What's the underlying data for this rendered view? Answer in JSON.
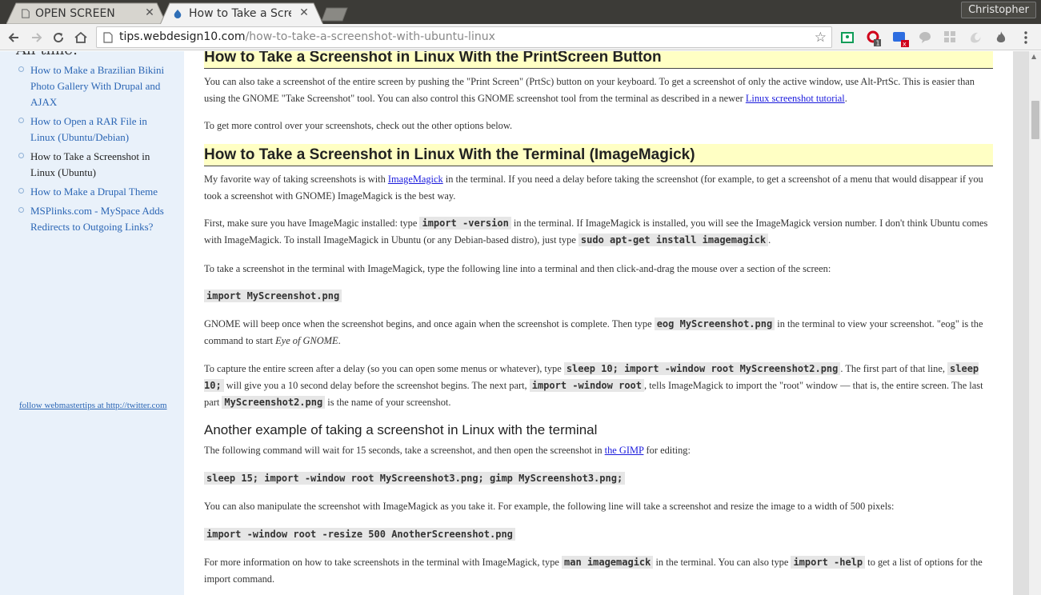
{
  "tabs": [
    {
      "title": "OPEN SCREEN",
      "active": false
    },
    {
      "title": "How to Take a Scre",
      "active": true
    }
  ],
  "profile": {
    "name": "Christopher"
  },
  "omnibox": {
    "host": "tips.webdesign10.com",
    "path": "/how-to-take-a-screenshot-with-ubuntu-linux"
  },
  "extensions": [
    {
      "icon": "google-classroom-icon",
      "badge": ""
    },
    {
      "icon": "opera-icon",
      "badge": "1"
    },
    {
      "icon": "screen-capture-icon",
      "badge": "x"
    },
    {
      "icon": "speech-bubble-icon",
      "badge": ""
    },
    {
      "icon": "grid-icon",
      "badge": ""
    },
    {
      "icon": "swirl-icon",
      "badge": ""
    },
    {
      "icon": "flame-icon",
      "badge": ""
    }
  ],
  "sidebar": {
    "heading": "All time:",
    "items": [
      {
        "label": "How to Make a Brazilian Bikini Photo Gallery With Drupal and AJAX",
        "current": false
      },
      {
        "label": "How to Open a RAR File in Linux (Ubuntu/Debian)",
        "current": false
      },
      {
        "label": "How to Take a Screenshot in Linux (Ubuntu)",
        "current": true
      },
      {
        "label": "How to Make a Drupal Theme",
        "current": false
      },
      {
        "label": "MSPlinks.com - MySpace Adds Redirects to Outgoing Links?",
        "current": false
      }
    ],
    "follow": "follow webmastertips at http://twitter.com"
  },
  "article": {
    "h_printscreen": "How to Take a Screenshot in Linux With the PrintScreen Button",
    "p1_a": "You can also take a screenshot of the entire screen by pushing the \"Print Screen\" (PrtSc) button on your keyboard. To get a screenshot of only the active window, use Alt-PrtSc. This is easier than using the GNOME \"Take Screenshot\" tool. You can also control this GNOME screenshot tool from the terminal as described in a newer ",
    "p1_link": "Linux screenshot tutorial",
    "p1_b": ".",
    "p2": "To get more control over your screenshots, check out the other options below.",
    "h_terminal": "How to Take a Screenshot in Linux With the Terminal (ImageMagick)",
    "p3_a": "My favorite way of taking screenshots is with ",
    "p3_link": "ImageMagick",
    "p3_b": " in the terminal. If you need a delay before taking the screenshot (for example, to get a screenshot of a menu that would disappear if you took a screenshot with GNOME) ImageMagick is the best way.",
    "p4_a": "First, make sure you have ImageMagic installed: type ",
    "p4_code1": "import -version",
    "p4_b": " in the terminal. If ImageMagick is installed, you will see the ImageMagick version number. I don't think Ubuntu comes with ImageMagick. To install ImageMagick in Ubuntu (or any Debian-based distro), just type ",
    "p4_code2": "sudo apt-get install imagemagick",
    "p4_c": ".",
    "p5": "To take a screenshot in the terminal with ImageMagick, type the following line into a terminal and then click-and-drag the mouse over a section of the screen:",
    "code1": "import MyScreenshot.png",
    "p6_a": "GNOME will beep once when the screenshot begins, and once again when the screenshot is complete. Then type ",
    "p6_code": "eog MyScreenshot.png",
    "p6_b": " in the terminal to view your screenshot. \"eog\" is the command to start ",
    "p6_em": "Eye of GNOME",
    "p6_c": ".",
    "p7_a": "To capture the entire screen after a delay (so you can open some menus or whatever), type ",
    "p7_code1": "sleep 10; import -window root MyScreenshot2.png",
    "p7_b": ". The first part of that line, ",
    "p7_code2": "sleep 10;",
    "p7_c": " will give you a 10 second delay before the screenshot begins. The next part, ",
    "p7_code3": "import -window root",
    "p7_d": ", tells ImageMagick to import the \"root\" window — that is, the entire screen. The last part ",
    "p7_code4": "MyScreenshot2.png",
    "p7_e": " is the name of your screenshot.",
    "h_another": "Another example of taking a screenshot in Linux with the terminal",
    "p8_a": "The following command will wait for 15 seconds, take a screenshot, and then open the screenshot in ",
    "p8_link": "the GIMP",
    "p8_b": " for editing:",
    "code2": "sleep 15; import -window root MyScreenshot3.png; gimp MyScreenshot3.png;",
    "p9": "You can also manipulate the screenshot with ImageMagick as you take it. For example, the following line will take a screenshot and resize the image to a width of 500 pixels:",
    "code3": "import -window root -resize 500 AnotherScreenshot.png",
    "p10_a": "For more information on how to take screenshots in the terminal with ImageMagick, type ",
    "p10_code1": "man imagemagick",
    "p10_b": " in the terminal. You can also type ",
    "p10_code2": "import -help",
    "p10_c": " to get a list of options for the import command."
  },
  "colors": {
    "link": "#1a1adc",
    "sidebar_link": "#2a65b4",
    "heading_highlight": "#ffffc4",
    "sidebar_bg": "#e9f1fa",
    "tabstrip_bg": "#3c3b37"
  }
}
